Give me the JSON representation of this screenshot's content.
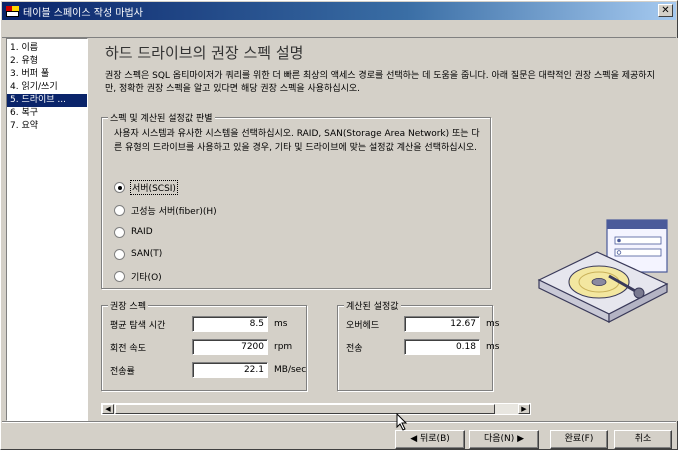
{
  "window": {
    "title": "테이블 스페이스 작성 마법사",
    "close_label": "✕"
  },
  "nav": {
    "items": [
      {
        "label": "1. 이름",
        "active": false
      },
      {
        "label": "2. 유형",
        "active": false
      },
      {
        "label": "3. 버퍼 풀",
        "active": false
      },
      {
        "label": "4. 읽기/쓰기",
        "active": false
      },
      {
        "label": "5. 드라이브 ...",
        "active": true
      },
      {
        "label": "6. 복구",
        "active": false
      },
      {
        "label": "7. 요약",
        "active": false
      }
    ]
  },
  "main": {
    "heading": "하드 드라이브의 권장 스펙 설명",
    "description": "권장 스펙은 SQL 옵티마이저가 쿼리를 위한 더 빠른 최상의 액세스 경로를 선택하는 데 도움을 줍니다. 아래 질문은 대략적인 권장 스펙을 제공하지만, 정확한 권장 스펙을 알고 있다면 해당 권장 스펙을 사용하십시오."
  },
  "env_group": {
    "title": "스펙 및 계산된 설정값 판별",
    "text": "사용자 시스템과 유사한 시스템을 선택하십시오. RAID, SAN(Storage Area Network) 또는 다른 유형의 드라이브를 사용하고 있을 경우, 기타 및 드라이브에 맞는 설정값 계산을 선택하십시오.",
    "options": [
      {
        "label": "서버(SCSI)",
        "checked": true
      },
      {
        "label": "고성능 서버(fiber)(H)",
        "checked": false
      },
      {
        "label": "RAID",
        "checked": false
      },
      {
        "label": "SAN(T)",
        "checked": false
      },
      {
        "label": "기타(O)",
        "checked": false
      }
    ]
  },
  "spec_group": {
    "title": "권장 스펙",
    "fields": [
      {
        "label": "평균 탐색 시간",
        "value": "8.5",
        "unit": "ms"
      },
      {
        "label": "회전 속도",
        "value": "7200",
        "unit": "rpm"
      },
      {
        "label": "전송률",
        "value": "22.1",
        "unit": "MB/sec"
      }
    ]
  },
  "calc_group": {
    "title": "계산된 설정값",
    "fields": [
      {
        "label": "오버헤드",
        "value": "12.67",
        "unit": "ms"
      },
      {
        "label": "전송",
        "value": "0.18",
        "unit": "ms"
      }
    ]
  },
  "buttons": {
    "back": "◀ 뒤로(B)",
    "next": "다음(N) ▶",
    "finish": "완료(F)",
    "cancel": "취소"
  },
  "icons": {
    "app": "db2-wizard-icon",
    "illustration": "hard-drive-with-settings-window",
    "cursor": "mouse-pointer-icon"
  }
}
